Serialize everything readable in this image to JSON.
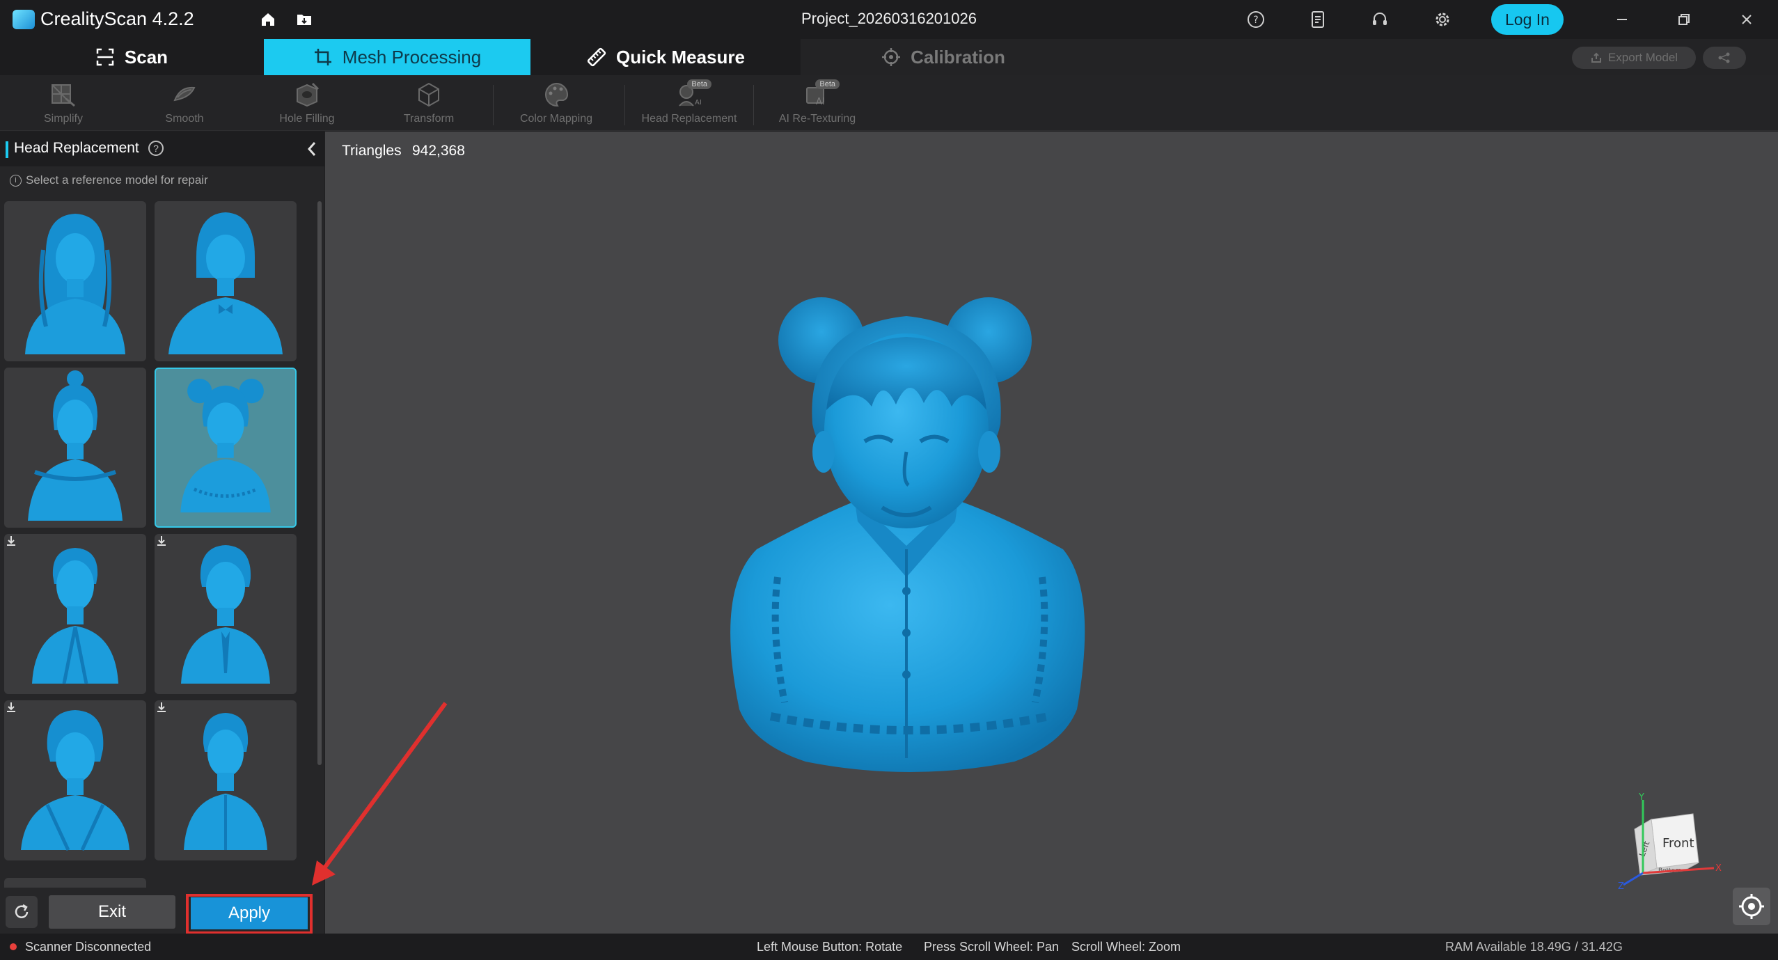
{
  "app": {
    "title": "CrealityScan 4.2.2",
    "project_name": "Project_20260316201026",
    "login_label": "Log In",
    "header_icons": [
      "home-icon",
      "folder-icon",
      "help-icon",
      "manual-icon",
      "support-headset-icon",
      "settings-gear-icon"
    ],
    "window_controls": [
      "minimize-icon",
      "restore-icon",
      "close-icon"
    ]
  },
  "mode_tabs": [
    {
      "label": "Scan",
      "icon": "scan-frame-icon",
      "state": "normal"
    },
    {
      "label": "Mesh Processing",
      "icon": "mesh-crop-icon",
      "state": "active"
    },
    {
      "label": "Quick Measure",
      "icon": "ruler-icon",
      "state": "normal"
    },
    {
      "label": "Calibration",
      "icon": "crosshair-icon",
      "state": "disabled"
    }
  ],
  "export": {
    "label": "Export Model",
    "icon": "export-icon",
    "share_icon": "share-icon"
  },
  "toolbar": [
    {
      "label": "Simplify",
      "icon": "simplify-icon",
      "beta": ""
    },
    {
      "label": "Smooth",
      "icon": "smooth-icon",
      "beta": ""
    },
    {
      "label": "Hole Filling",
      "icon": "hole-filling-icon",
      "beta": ""
    },
    {
      "label": "Transform",
      "icon": "transform-cube-icon",
      "beta": ""
    },
    {
      "label": "Color Mapping",
      "icon": "palette-icon",
      "beta": ""
    },
    {
      "label": "Head Replacement",
      "icon": "head-replace-icon",
      "beta": "Beta"
    },
    {
      "label": "AI Re-Texturing",
      "icon": "ai-texture-icon",
      "beta": "Beta"
    }
  ],
  "panel": {
    "title": "Head Replacement",
    "hint": "Select a reference model for repair",
    "exit_label": "Exit",
    "apply_label": "Apply",
    "models": [
      {
        "style": "long-wavy-hair-female",
        "selected": false,
        "downloadable": false
      },
      {
        "style": "bob-hair-female-bow",
        "selected": false,
        "downloadable": false
      },
      {
        "style": "bun-hair-female",
        "selected": false,
        "downloadable": false
      },
      {
        "style": "double-bun-girl",
        "selected": true,
        "downloadable": false
      },
      {
        "style": "male-suit-short-hair",
        "selected": false,
        "downloadable": true
      },
      {
        "style": "male-tie-wavy-hair",
        "selected": false,
        "downloadable": true
      },
      {
        "style": "male-curly-hair-coat",
        "selected": false,
        "downloadable": true
      },
      {
        "style": "male-casual-jacket",
        "selected": false,
        "downloadable": true
      }
    ]
  },
  "viewport": {
    "triangles_label": "Triangles",
    "triangles_value": "942,368",
    "nav_cube": {
      "front": "Front",
      "left": "Left",
      "bottom": "Bottom",
      "axes": [
        "X",
        "Y",
        "Z"
      ]
    }
  },
  "status": {
    "scanner": "Scanner Disconnected",
    "hint_rotate": "Left Mouse Button: Rotate",
    "hint_pan": "Press Scroll Wheel: Pan",
    "hint_zoom": "Scroll Wheel: Zoom",
    "ram": "RAM Available 18.49G / 31.42G"
  },
  "colors": {
    "accent": "#1ccaf0",
    "model_blue": "#1a9ad8",
    "apply_blue": "#1893d8",
    "highlight_red": "#e0302e",
    "status_red": "#e8403c"
  }
}
